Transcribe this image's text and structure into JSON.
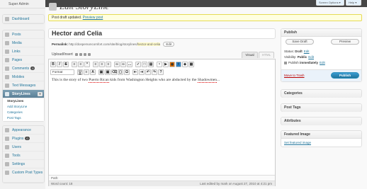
{
  "admin_bar": {
    "screen_options": "Screen Options ▾",
    "help": "Help ▾"
  },
  "sidebar": {
    "site_title": "Super Admin",
    "dashboard": "Dashboard",
    "items": [
      {
        "label": "Posts",
        "icon": "pin-icon"
      },
      {
        "label": "Media",
        "icon": "media-icon"
      },
      {
        "label": "Links",
        "icon": "links-icon"
      },
      {
        "label": "Pages",
        "icon": "pages-icon"
      },
      {
        "label": "Comments",
        "icon": "comments-icon",
        "badge": "0"
      },
      {
        "label": "Mobiles",
        "icon": "mobile-icon"
      },
      {
        "label": "Text Messages",
        "icon": "text-messages-icon"
      }
    ],
    "storylines": {
      "label": "StoryLines",
      "submenu": [
        "StoryLines",
        "Add StoryLine",
        "Categories",
        "Post Tags"
      ]
    },
    "items2": [
      {
        "label": "Appearance",
        "icon": "appearance-icon"
      },
      {
        "label": "Plugins",
        "icon": "plugins-icon",
        "badge": "0"
      },
      {
        "label": "Users",
        "icon": "users-icon"
      },
      {
        "label": "Tools",
        "icon": "tools-icon"
      },
      {
        "label": "Settings",
        "icon": "settings-icon"
      },
      {
        "label": "Custom Post Types",
        "icon": "custom-post-types-icon"
      }
    ]
  },
  "header": {
    "title": "Edit StoryLine"
  },
  "notice": {
    "text": "Post draft updated.",
    "link": "Preview post"
  },
  "post": {
    "title": "Hector and Celia",
    "permalink_label": "Permalink:",
    "permalink_base": "http://dospersoncomfort.com/site/blog/storylines/",
    "permalink_slug": "hector-and-celia",
    "permalink_edit": "Edit"
  },
  "editor": {
    "upload_insert": "Upload/Insert",
    "tab_visual": "Visual",
    "tab_html": "HTML",
    "format_select": "Format",
    "content_1": "This is the story of two ",
    "content_2": "Puerto Rican",
    "content_3": " kids from Washington Heights who are abducted by the ",
    "content_4": "Shadowmen",
    "content_5": "...",
    "path": "Path:",
    "word_count": "Word count: 18",
    "last_edited": "Last edited by mark on August 27, 2010 at 4:21 pm"
  },
  "publish": {
    "title": "Publish",
    "save_draft": "Save Draft",
    "preview": "Preview",
    "status_label": "Status:",
    "status_value": "Draft",
    "status_edit": "Edit",
    "visibility_label": "Visibility:",
    "visibility_value": "Public",
    "visibility_edit": "Edit",
    "publish_label": "Publish",
    "publish_value": "immediately",
    "publish_edit": "Edit",
    "trash": "Move to Trash",
    "publish_button": "Publish"
  },
  "boxes": {
    "categories": "Categories",
    "post_tags": "Post Tags",
    "attributes": "Attributes",
    "featured_image": "Featured Image",
    "set_featured": "Set featured image"
  },
  "colors": {
    "link": "#21759b",
    "current_menu": "#6d8fa3",
    "publish_button": "#21759b",
    "notice_bg": "#ffffe0"
  }
}
